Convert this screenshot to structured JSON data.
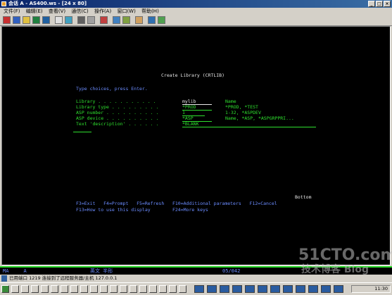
{
  "window": {
    "title": "会话 A - AS400.ws - [24 x 80]",
    "controls": [
      "_",
      "□",
      "×"
    ]
  },
  "menu": [
    "文件(F)",
    "编辑(E)",
    "查看(V)",
    "通信(C)",
    "操作(A)",
    "窗口(W)",
    "帮助(H)"
  ],
  "screen": {
    "heading": "Create Library (CRTLIB)",
    "instruction": "Type choices, press Enter.",
    "fields": [
      {
        "label": "Library . . . . . . . . . . .",
        "value": "mylib",
        "hint": "Name"
      },
      {
        "label": "Library type . . . . . . . . .",
        "value": "*PROD",
        "hint": "*PROD, *TEST"
      },
      {
        "label": "ASP number . . . . . . . . . .",
        "value": "1",
        "hint": "1-32, *ASPDEV"
      },
      {
        "label": "ASP device . . . . . . . . . .",
        "value": "*ASP",
        "hint": "Name, *ASP, *ASPGRPPRI..."
      },
      {
        "label": "Text 'description' . . . . . .",
        "value": "*BLANK",
        "hint": ""
      }
    ],
    "bottom_marker": "Bottom",
    "fkeys_line1": "F3=Exit   F4=Prompt   F5=Refresh   F10=Additional parameters   F12=Cancel",
    "fkeys_line2": "F13=How to use this display        F24=More keys"
  },
  "oia": {
    "left": "MA     A",
    "mode": "英文 半形",
    "position": "05/042"
  },
  "status": {
    "message": "已用端口 1219 连接到了远程服务器/主机 127.0.0.1"
  },
  "taskbar": {
    "clock": "11:30"
  },
  "watermark": {
    "line1": "51CTO.com",
    "line2": "技术博客  Blog"
  }
}
